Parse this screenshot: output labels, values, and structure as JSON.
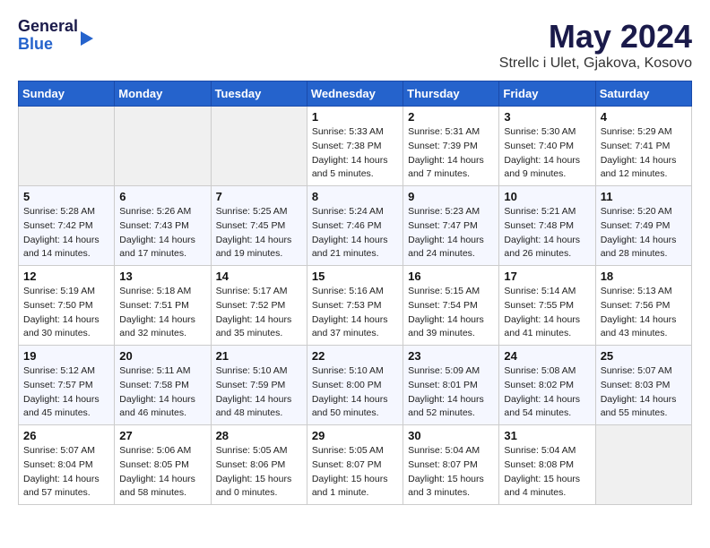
{
  "header": {
    "logo": {
      "general": "General",
      "blue": "Blue"
    },
    "title": "May 2024",
    "location": "Strellc i Ulet, Gjakova, Kosovo"
  },
  "weekdays": [
    "Sunday",
    "Monday",
    "Tuesday",
    "Wednesday",
    "Thursday",
    "Friday",
    "Saturday"
  ],
  "weeks": [
    [
      {
        "day": null
      },
      {
        "day": null
      },
      {
        "day": null
      },
      {
        "day": "1",
        "sunrise": "Sunrise: 5:33 AM",
        "sunset": "Sunset: 7:38 PM",
        "daylight": "Daylight: 14 hours and 5 minutes."
      },
      {
        "day": "2",
        "sunrise": "Sunrise: 5:31 AM",
        "sunset": "Sunset: 7:39 PM",
        "daylight": "Daylight: 14 hours and 7 minutes."
      },
      {
        "day": "3",
        "sunrise": "Sunrise: 5:30 AM",
        "sunset": "Sunset: 7:40 PM",
        "daylight": "Daylight: 14 hours and 9 minutes."
      },
      {
        "day": "4",
        "sunrise": "Sunrise: 5:29 AM",
        "sunset": "Sunset: 7:41 PM",
        "daylight": "Daylight: 14 hours and 12 minutes."
      }
    ],
    [
      {
        "day": "5",
        "sunrise": "Sunrise: 5:28 AM",
        "sunset": "Sunset: 7:42 PM",
        "daylight": "Daylight: 14 hours and 14 minutes."
      },
      {
        "day": "6",
        "sunrise": "Sunrise: 5:26 AM",
        "sunset": "Sunset: 7:43 PM",
        "daylight": "Daylight: 14 hours and 17 minutes."
      },
      {
        "day": "7",
        "sunrise": "Sunrise: 5:25 AM",
        "sunset": "Sunset: 7:45 PM",
        "daylight": "Daylight: 14 hours and 19 minutes."
      },
      {
        "day": "8",
        "sunrise": "Sunrise: 5:24 AM",
        "sunset": "Sunset: 7:46 PM",
        "daylight": "Daylight: 14 hours and 21 minutes."
      },
      {
        "day": "9",
        "sunrise": "Sunrise: 5:23 AM",
        "sunset": "Sunset: 7:47 PM",
        "daylight": "Daylight: 14 hours and 24 minutes."
      },
      {
        "day": "10",
        "sunrise": "Sunrise: 5:21 AM",
        "sunset": "Sunset: 7:48 PM",
        "daylight": "Daylight: 14 hours and 26 minutes."
      },
      {
        "day": "11",
        "sunrise": "Sunrise: 5:20 AM",
        "sunset": "Sunset: 7:49 PM",
        "daylight": "Daylight: 14 hours and 28 minutes."
      }
    ],
    [
      {
        "day": "12",
        "sunrise": "Sunrise: 5:19 AM",
        "sunset": "Sunset: 7:50 PM",
        "daylight": "Daylight: 14 hours and 30 minutes."
      },
      {
        "day": "13",
        "sunrise": "Sunrise: 5:18 AM",
        "sunset": "Sunset: 7:51 PM",
        "daylight": "Daylight: 14 hours and 32 minutes."
      },
      {
        "day": "14",
        "sunrise": "Sunrise: 5:17 AM",
        "sunset": "Sunset: 7:52 PM",
        "daylight": "Daylight: 14 hours and 35 minutes."
      },
      {
        "day": "15",
        "sunrise": "Sunrise: 5:16 AM",
        "sunset": "Sunset: 7:53 PM",
        "daylight": "Daylight: 14 hours and 37 minutes."
      },
      {
        "day": "16",
        "sunrise": "Sunrise: 5:15 AM",
        "sunset": "Sunset: 7:54 PM",
        "daylight": "Daylight: 14 hours and 39 minutes."
      },
      {
        "day": "17",
        "sunrise": "Sunrise: 5:14 AM",
        "sunset": "Sunset: 7:55 PM",
        "daylight": "Daylight: 14 hours and 41 minutes."
      },
      {
        "day": "18",
        "sunrise": "Sunrise: 5:13 AM",
        "sunset": "Sunset: 7:56 PM",
        "daylight": "Daylight: 14 hours and 43 minutes."
      }
    ],
    [
      {
        "day": "19",
        "sunrise": "Sunrise: 5:12 AM",
        "sunset": "Sunset: 7:57 PM",
        "daylight": "Daylight: 14 hours and 45 minutes."
      },
      {
        "day": "20",
        "sunrise": "Sunrise: 5:11 AM",
        "sunset": "Sunset: 7:58 PM",
        "daylight": "Daylight: 14 hours and 46 minutes."
      },
      {
        "day": "21",
        "sunrise": "Sunrise: 5:10 AM",
        "sunset": "Sunset: 7:59 PM",
        "daylight": "Daylight: 14 hours and 48 minutes."
      },
      {
        "day": "22",
        "sunrise": "Sunrise: 5:10 AM",
        "sunset": "Sunset: 8:00 PM",
        "daylight": "Daylight: 14 hours and 50 minutes."
      },
      {
        "day": "23",
        "sunrise": "Sunrise: 5:09 AM",
        "sunset": "Sunset: 8:01 PM",
        "daylight": "Daylight: 14 hours and 52 minutes."
      },
      {
        "day": "24",
        "sunrise": "Sunrise: 5:08 AM",
        "sunset": "Sunset: 8:02 PM",
        "daylight": "Daylight: 14 hours and 54 minutes."
      },
      {
        "day": "25",
        "sunrise": "Sunrise: 5:07 AM",
        "sunset": "Sunset: 8:03 PM",
        "daylight": "Daylight: 14 hours and 55 minutes."
      }
    ],
    [
      {
        "day": "26",
        "sunrise": "Sunrise: 5:07 AM",
        "sunset": "Sunset: 8:04 PM",
        "daylight": "Daylight: 14 hours and 57 minutes."
      },
      {
        "day": "27",
        "sunrise": "Sunrise: 5:06 AM",
        "sunset": "Sunset: 8:05 PM",
        "daylight": "Daylight: 14 hours and 58 minutes."
      },
      {
        "day": "28",
        "sunrise": "Sunrise: 5:05 AM",
        "sunset": "Sunset: 8:06 PM",
        "daylight": "Daylight: 15 hours and 0 minutes."
      },
      {
        "day": "29",
        "sunrise": "Sunrise: 5:05 AM",
        "sunset": "Sunset: 8:07 PM",
        "daylight": "Daylight: 15 hours and 1 minute."
      },
      {
        "day": "30",
        "sunrise": "Sunrise: 5:04 AM",
        "sunset": "Sunset: 8:07 PM",
        "daylight": "Daylight: 15 hours and 3 minutes."
      },
      {
        "day": "31",
        "sunrise": "Sunrise: 5:04 AM",
        "sunset": "Sunset: 8:08 PM",
        "daylight": "Daylight: 15 hours and 4 minutes."
      },
      {
        "day": null
      }
    ]
  ]
}
